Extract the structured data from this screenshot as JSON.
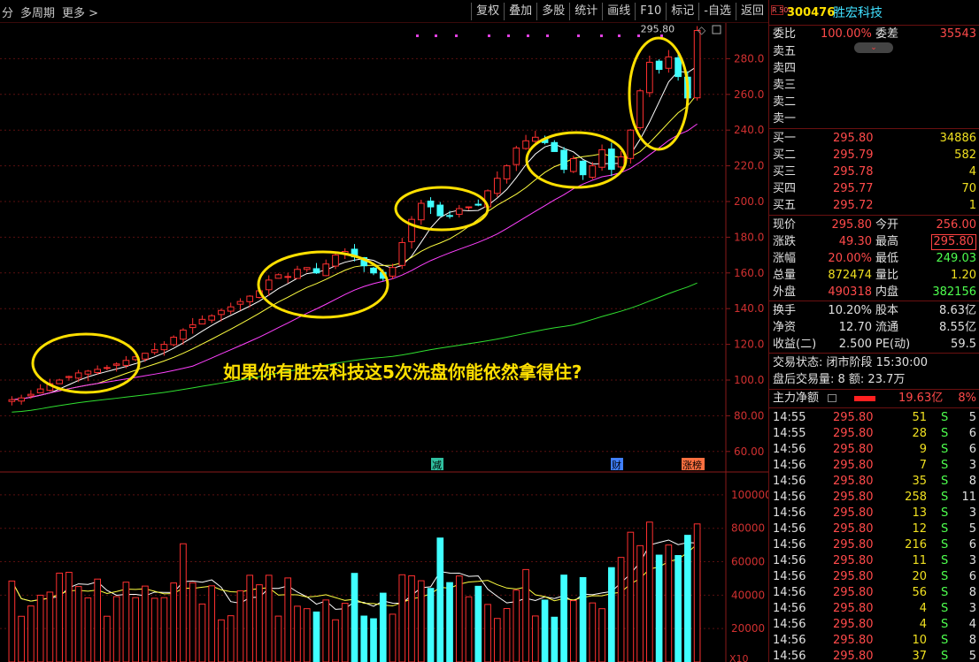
{
  "toolbar": {
    "left_items": [
      "分",
      "多周期",
      "更多 >"
    ],
    "right_items": [
      "复权",
      "叠加",
      "多股",
      "统计",
      "画线",
      "F10",
      "标记",
      "-自选",
      "返回"
    ]
  },
  "headline": "如果你有胜宏科技这5次洗盘你能依然拿得住?",
  "chart": {
    "price_axis": [
      "280.0",
      "260.0",
      "240.0",
      "220.0",
      "200.0",
      "180.0",
      "160.0",
      "140.0",
      "120.0",
      "100.0",
      "80.00",
      "60.00"
    ],
    "high_label": "295.80",
    "markers": [
      {
        "text": "减",
        "color": "#30c0a0"
      },
      {
        "text": "财",
        "color": "#4080ff"
      },
      {
        "text": "涨榜",
        "color": "#ff7040"
      }
    ],
    "volume_axis": [
      "100000",
      "80000",
      "60000",
      "40000",
      "20000"
    ],
    "volume_unit": "X10"
  },
  "chart_data": {
    "type": "candlestick",
    "ylim": [
      50,
      300
    ],
    "closes": [
      89,
      90,
      92,
      95,
      98,
      100,
      102,
      104,
      105,
      106,
      107,
      109,
      111,
      113,
      115,
      117,
      120,
      124,
      128,
      131,
      134,
      136,
      139,
      141,
      144,
      147,
      150,
      156,
      159,
      158,
      162,
      163,
      160,
      165,
      170,
      172,
      169,
      164,
      160,
      157,
      163,
      177,
      190,
      199,
      197,
      192,
      192,
      196,
      197,
      198,
      206,
      213,
      220,
      230,
      234,
      236,
      233,
      228,
      218,
      224,
      215,
      220,
      229,
      218,
      225,
      240,
      262,
      278,
      274,
      281,
      270,
      258,
      295.8
    ],
    "volume_ylim": [
      0,
      110000
    ]
  },
  "panel": {
    "logo": "R 500",
    "code": "300476",
    "name": "胜宏科技",
    "weibi_label": "委比",
    "weibi_value": "100.00%",
    "weicha_label": "委差",
    "weicha_value": "35543",
    "sell_labels": [
      "卖五",
      "卖四",
      "卖三",
      "卖二",
      "卖一"
    ],
    "buys": [
      {
        "label": "买一",
        "price": "295.80",
        "vol": "34886"
      },
      {
        "label": "买二",
        "price": "295.79",
        "vol": "582"
      },
      {
        "label": "买三",
        "price": "295.78",
        "vol": "4"
      },
      {
        "label": "买四",
        "price": "295.77",
        "vol": "70"
      },
      {
        "label": "买五",
        "price": "295.72",
        "vol": "1"
      }
    ],
    "stats": [
      {
        "l1": "现价",
        "v1": "295.80",
        "l2": "今开",
        "v2": "256.00"
      },
      {
        "l1": "涨跌",
        "v1": "49.30",
        "l2": "最高",
        "v2": "295.80"
      },
      {
        "l1": "涨幅",
        "v1": "20.00%",
        "l2": "最低",
        "v2": "249.03"
      },
      {
        "l1": "总量",
        "v1": "872474",
        "l2": "量比",
        "v2": "1.20"
      },
      {
        "l1": "外盘",
        "v1": "490318",
        "l2": "内盘",
        "v2": "382156"
      }
    ],
    "stats2": [
      {
        "l1": "换手",
        "v1": "10.20%",
        "l2": "股本",
        "v2": "8.63亿"
      },
      {
        "l1": "净资",
        "v1": "12.70",
        "l2": "流通",
        "v2": "8.55亿"
      },
      {
        "l1": "收益(二)",
        "v1": "2.500",
        "l2": "PE(动)",
        "v2": "59.5"
      }
    ],
    "trade_status": "交易状态: 闭市阶段 15:30:00",
    "after_hours": "盘后交易量: 8  额: 23.7万",
    "main_force_label": "主力净额",
    "main_force_value": "19.63亿",
    "main_force_pct": "8%",
    "ticks": [
      {
        "t": "14:55",
        "p": "295.80",
        "v": "51",
        "s": "S",
        "n": "5"
      },
      {
        "t": "14:55",
        "p": "295.80",
        "v": "28",
        "s": "S",
        "n": "6"
      },
      {
        "t": "14:56",
        "p": "295.80",
        "v": "9",
        "s": "S",
        "n": "6"
      },
      {
        "t": "14:56",
        "p": "295.80",
        "v": "7",
        "s": "S",
        "n": "3"
      },
      {
        "t": "14:56",
        "p": "295.80",
        "v": "35",
        "s": "S",
        "n": "8"
      },
      {
        "t": "14:56",
        "p": "295.80",
        "v": "258",
        "s": "S",
        "n": "11"
      },
      {
        "t": "14:56",
        "p": "295.80",
        "v": "13",
        "s": "S",
        "n": "3"
      },
      {
        "t": "14:56",
        "p": "295.80",
        "v": "12",
        "s": "S",
        "n": "5"
      },
      {
        "t": "14:56",
        "p": "295.80",
        "v": "216",
        "s": "S",
        "n": "6"
      },
      {
        "t": "14:56",
        "p": "295.80",
        "v": "11",
        "s": "S",
        "n": "3"
      },
      {
        "t": "14:56",
        "p": "295.80",
        "v": "20",
        "s": "S",
        "n": "6"
      },
      {
        "t": "14:56",
        "p": "295.80",
        "v": "56",
        "s": "S",
        "n": "8"
      },
      {
        "t": "14:56",
        "p": "295.80",
        "v": "4",
        "s": "S",
        "n": "3"
      },
      {
        "t": "14:56",
        "p": "295.80",
        "v": "4",
        "s": "S",
        "n": "4"
      },
      {
        "t": "14:56",
        "p": "295.80",
        "v": "10",
        "s": "S",
        "n": "8"
      },
      {
        "t": "14:56",
        "p": "295.80",
        "v": "37",
        "s": "S",
        "n": "5"
      }
    ]
  }
}
